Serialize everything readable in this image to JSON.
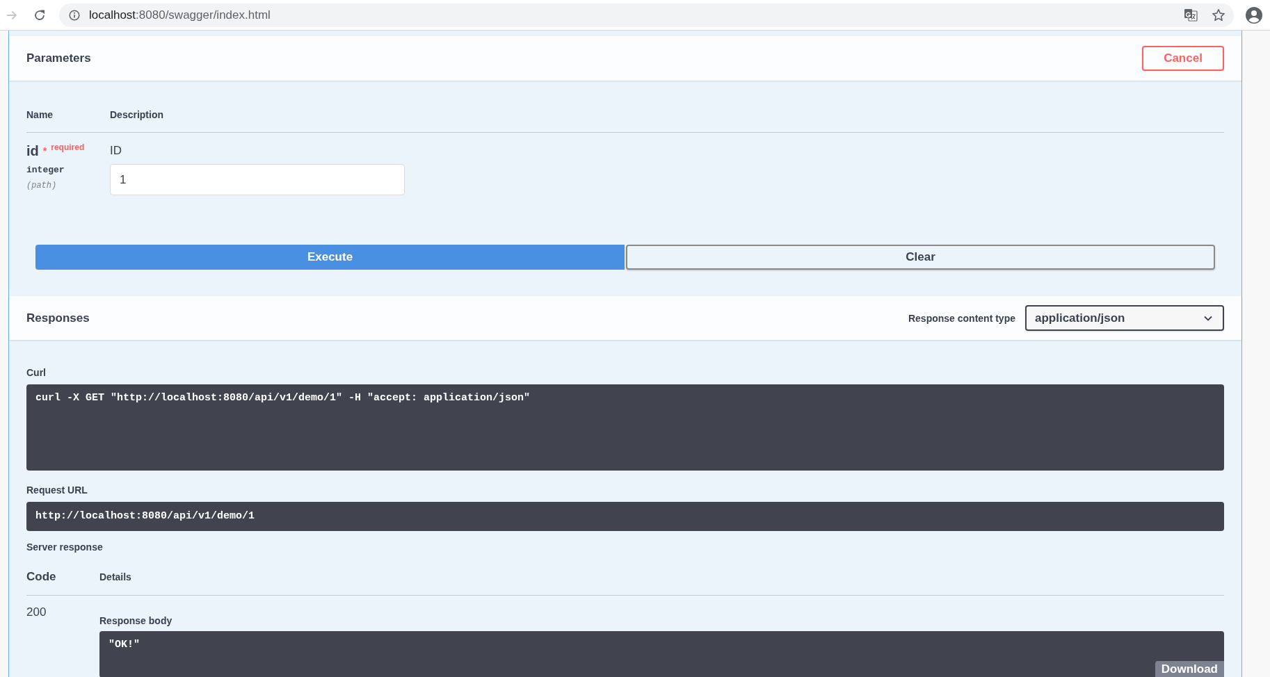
{
  "browser": {
    "forward_button": {
      "disabled": true
    },
    "url": {
      "host": "localhost",
      "path": ":8080/swagger/index.html"
    }
  },
  "parameters": {
    "title": "Parameters",
    "cancel_button": "Cancel",
    "columns": [
      "Name",
      "Description"
    ],
    "rows": [
      {
        "name": "id",
        "required": true,
        "required_mark": "*",
        "required_label": "required",
        "type": "integer",
        "location": "(path)",
        "description": "ID",
        "value": "1"
      }
    ]
  },
  "actions": [
    {
      "label": "Execute",
      "kind": "primary"
    },
    {
      "label": "Clear",
      "kind": "secondary"
    }
  ],
  "responses": {
    "title": "Responses",
    "content_type_label": "Response content type",
    "content_type": "application/json",
    "curl_label": "Curl",
    "curl": "curl -X GET \"http://localhost:8080/api/v1/demo/1\" -H \"accept: application/json\"",
    "request_url_label": "Request URL",
    "request_url": "http://localhost:8080/api/v1/demo/1",
    "server_response_label": "Server response",
    "columns": [
      "Code",
      "Details"
    ],
    "rows": [
      {
        "code": "200",
        "body_label": "Response body",
        "body": "\"OK!\"",
        "download_button": "Download"
      }
    ]
  }
}
